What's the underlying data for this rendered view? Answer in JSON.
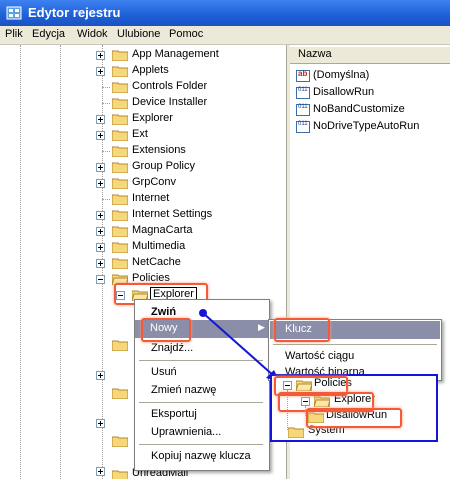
{
  "window": {
    "title": "Edytor rejestru"
  },
  "menu": [
    "Plik",
    "Edycja",
    "Widok",
    "Ulubione",
    "Pomoc"
  ],
  "tree": {
    "items": [
      "App Management",
      "Applets",
      "Controls Folder",
      "Device Installer",
      "Explorer",
      "Ext",
      "Extensions",
      "Group Policy",
      "GrpConv",
      "Internet",
      "Internet Settings",
      "MagnaCarta",
      "Multimedia",
      "NetCache",
      "Policies"
    ],
    "explorer_child": "Explorer",
    "bottom_item": "UnreadMail"
  },
  "values_pane": {
    "header": "Nazwa",
    "items": [
      {
        "icon": "ab-icon",
        "name": "(Domyślna)"
      },
      {
        "icon": "binary-icon",
        "name": "DisallowRun"
      },
      {
        "icon": "binary-icon",
        "name": "NoBandCustomize"
      },
      {
        "icon": "binary-icon",
        "name": "NoDriveTypeAutoRun"
      }
    ]
  },
  "context_menu": {
    "items": [
      "Zwiń",
      "Nowy",
      "Znajdź...",
      "Usuń",
      "Zmień nazwę",
      "Eksportuj",
      "Uprawnienia...",
      "Kopiuj nazwę klucza"
    ]
  },
  "submenu": {
    "items": [
      "Klucz",
      "Wartość ciągu",
      "Wartość binarna"
    ]
  },
  "inset": {
    "items": [
      "Policies",
      "Explorer",
      "DisallowRun",
      "System"
    ]
  },
  "colors": {
    "highlight": "#f35b38",
    "inset_border": "#1515d6",
    "titlebar": "#1f5fd8"
  }
}
